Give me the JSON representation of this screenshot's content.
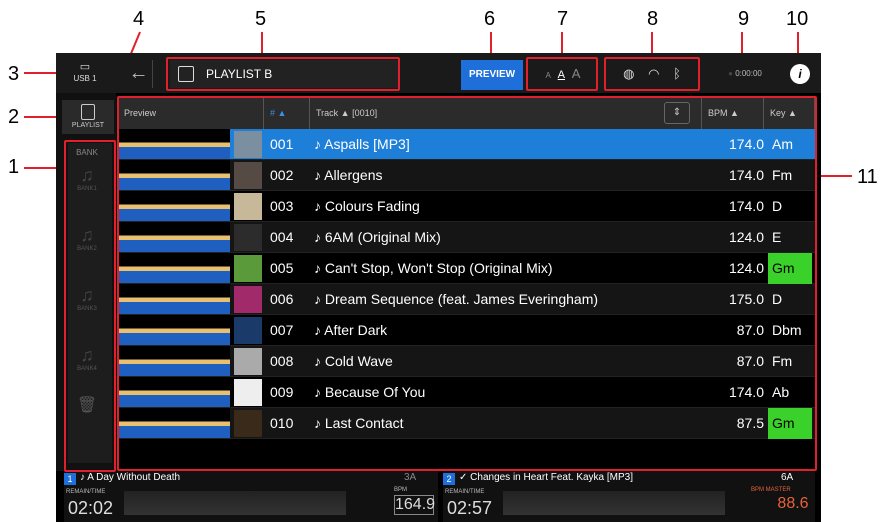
{
  "callouts": [
    "1",
    "2",
    "3",
    "4",
    "5",
    "6",
    "7",
    "8",
    "9",
    "10",
    "11"
  ],
  "topbar": {
    "usb_label": "USB 1",
    "playlist_title": "PLAYLIST B",
    "preview_label": "PREVIEW",
    "font_sizes": [
      "A",
      "A",
      "A"
    ],
    "time": "0:00:00",
    "info": "i"
  },
  "leftnav": {
    "playlist_label": "PLAYLIST",
    "bank_header": "BANK",
    "banks": [
      "BANK1",
      "BANK2",
      "BANK3",
      "BANK4"
    ]
  },
  "table": {
    "headers": {
      "preview": "Preview",
      "num": "# ▲",
      "track": "Track ▲  [0010]",
      "bpm": "BPM ▲",
      "key": "Key ▲"
    },
    "rows": [
      {
        "num": "001",
        "track": "Aspalls [MP3]",
        "bpm": "174.0",
        "key": "Am",
        "selected": true,
        "green": false
      },
      {
        "num": "002",
        "track": "Allergens",
        "bpm": "174.0",
        "key": "Fm",
        "selected": false,
        "green": false
      },
      {
        "num": "003",
        "track": "Colours Fading",
        "bpm": "174.0",
        "key": "D",
        "selected": false,
        "green": false
      },
      {
        "num": "004",
        "track": "6AM (Original Mix)",
        "bpm": "124.0",
        "key": "E",
        "selected": false,
        "green": false
      },
      {
        "num": "005",
        "track": "Can't Stop, Won't Stop (Original Mix)",
        "bpm": "124.0",
        "key": "Gm",
        "selected": false,
        "green": true
      },
      {
        "num": "006",
        "track": "Dream Sequence (feat. James Everingham)",
        "bpm": "175.0",
        "key": "D",
        "selected": false,
        "green": false
      },
      {
        "num": "007",
        "track": "After Dark",
        "bpm": "87.0",
        "key": "Dbm",
        "selected": false,
        "green": false
      },
      {
        "num": "008",
        "track": "Cold Wave",
        "bpm": "87.0",
        "key": "Fm",
        "selected": false,
        "green": false
      },
      {
        "num": "009",
        "track": "Because Of You",
        "bpm": "174.0",
        "key": "Ab",
        "selected": false,
        "green": false
      },
      {
        "num": "010",
        "track": " Last Contact",
        "bpm": "87.5",
        "key": "Gm",
        "selected": false,
        "green": true
      }
    ]
  },
  "decks": [
    {
      "num": "1",
      "title": "♪ A Day Without Death",
      "key": "3A",
      "time_label": "REMAIN/TIME",
      "time": "02:02",
      "bpm_label": "BPM",
      "bpm": "164.9"
    },
    {
      "num": "2",
      "title": "✓ Changes in Heart Feat. Kayka [MP3]",
      "key": "6A",
      "time_label": "REMAIN/TIME",
      "time": "02:57",
      "bpm_label": "BPM MASTER",
      "bpm": "88.6"
    }
  ],
  "colors": {
    "accent": "#1e7fd9",
    "key_green": "#3ad12b",
    "callout_red": "#e0202a"
  }
}
